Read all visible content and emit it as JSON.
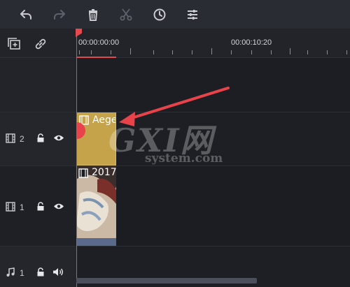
{
  "toolbar": {
    "buttons": [
      {
        "name": "undo-icon"
      },
      {
        "name": "redo-icon"
      },
      {
        "name": "delete-icon"
      },
      {
        "name": "cut-icon"
      },
      {
        "name": "speed-icon"
      },
      {
        "name": "adjust-icon"
      }
    ]
  },
  "panel": {
    "add_track_icon": "add-track-icon",
    "link_icon": "link-icon"
  },
  "ruler": {
    "timecode_start": "00:00:00:00",
    "timecode_mid": "00:00:10:20"
  },
  "tracks": [
    {
      "type": "video",
      "number": "2",
      "icons": [
        "film-icon",
        "lock-icon",
        "eye-icon"
      ]
    },
    {
      "type": "video",
      "number": "1",
      "icons": [
        "film-icon",
        "lock-icon",
        "eye-icon"
      ]
    },
    {
      "type": "audio",
      "number": "1",
      "icons": [
        "music-note-icon",
        "lock-icon",
        "speaker-icon"
      ]
    }
  ],
  "clips": {
    "title_clip": {
      "label": "Aege",
      "color": "#c4a34a"
    },
    "video_clip": {
      "label": "2017"
    }
  },
  "watermark": {
    "big": "GXI网",
    "small": "system.com"
  },
  "colors": {
    "playhead": "#e5484d",
    "accent_arrow": "#e8434a"
  }
}
